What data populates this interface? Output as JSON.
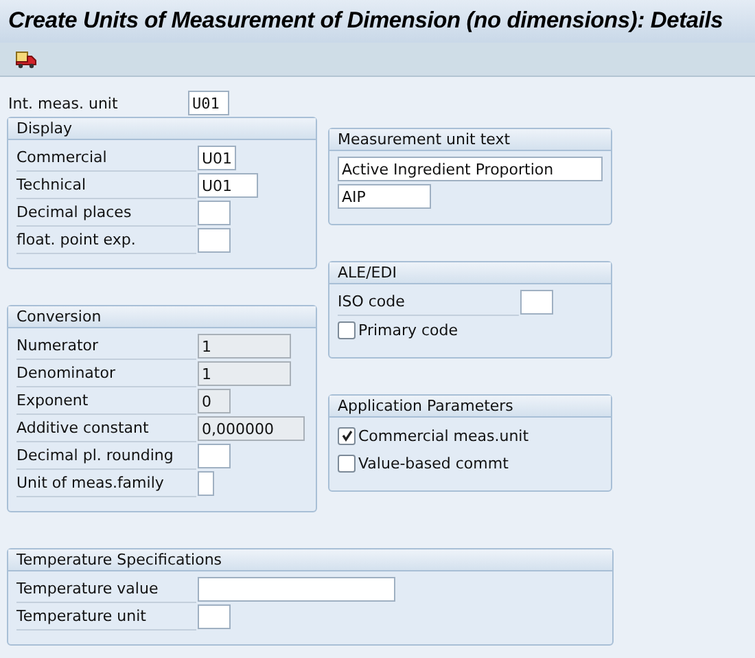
{
  "window": {
    "title": "Create Units of Measurement of Dimension (no dimensions): Details"
  },
  "top_field": {
    "label": "Int. meas. unit",
    "value": "U01",
    "disabled": false
  },
  "left_groups": [
    {
      "title": "Display",
      "fields": [
        {
          "label": "Commercial",
          "value": "U01",
          "disabled": false
        },
        {
          "label": "Technical",
          "value": "U01",
          "disabled": false
        },
        {
          "label": "Decimal places",
          "disabled": false
        },
        {
          "label": "float. point exp.",
          "disabled": false
        }
      ]
    },
    {
      "title": "Conversion",
      "fields": [
        {
          "label": "Numerator",
          "value": "1",
          "disabled": true
        },
        {
          "label": "Denominator",
          "value": "1",
          "disabled": true
        },
        {
          "label": "Exponent",
          "value": "0",
          "disabled": true
        },
        {
          "label": "Additive constant",
          "value": "0,000000",
          "disabled": true
        },
        {
          "label": "Decimal pl. rounding",
          "disabled": false
        },
        {
          "label": "Unit of meas.family",
          "disabled": false
        }
      ]
    }
  ],
  "right_groups": [
    {
      "title": "Measurement unit text",
      "items": [
        {
          "kind": "text",
          "value": "Active Ingredient Proportion"
        },
        {
          "kind": "text",
          "value": "AIP"
        }
      ]
    },
    {
      "title": "ALE/EDI",
      "items": [
        {
          "kind": "field",
          "label": "ISO code"
        },
        {
          "kind": "checkbox",
          "label": "Primary code",
          "checked": false
        }
      ]
    },
    {
      "title": "Application Parameters",
      "items": [
        {
          "kind": "checkbox",
          "label": "Commercial meas.unit",
          "checked": true
        },
        {
          "kind": "checkbox",
          "label": "Value-based commt",
          "checked": false
        }
      ]
    }
  ],
  "bottom_group": {
    "title": "Temperature Specifications",
    "fields": [
      {
        "label": "Temperature value",
        "disabled": false
      },
      {
        "label": "Temperature unit",
        "disabled": false
      }
    ]
  }
}
